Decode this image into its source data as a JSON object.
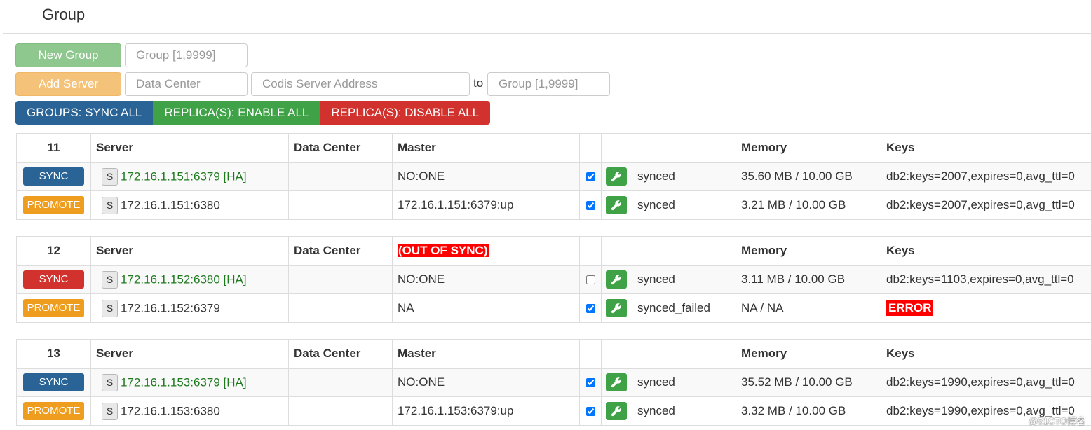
{
  "page_title": "Group",
  "toolbar": {
    "new_group_label": "New Group",
    "new_group_placeholder": "Group [1,9999]",
    "add_server_label": "Add Server",
    "data_center_placeholder": "Data Center",
    "server_address_placeholder": "Codis Server Address",
    "to_label": "to",
    "target_group_placeholder": "Group [1,9999]",
    "sync_all_label": "GROUPS: SYNC ALL",
    "enable_all_label": "REPLICA(S): ENABLE ALL",
    "disable_all_label": "REPLICA(S): DISABLE ALL"
  },
  "headers": {
    "server": "Server",
    "data_center": "Data Center",
    "master": "Master",
    "memory": "Memory",
    "keys": "Keys"
  },
  "server_button": "S",
  "groups": [
    {
      "id": "11",
      "master_header": "",
      "servers": [
        {
          "action": "SYNC",
          "address": "172.16.1.151:6379 [HA]",
          "data_center": "",
          "master": "NO:ONE",
          "checked": true,
          "status": "synced",
          "memory": "35.60 MB / 10.00 GB",
          "keys": "db2:keys=2007,expires=0,avg_ttl=0"
        },
        {
          "action": "PROMOTE",
          "address": "172.16.1.151:6380",
          "data_center": "",
          "master": "172.16.1.151:6379:up",
          "checked": true,
          "status": "synced",
          "memory": "3.21 MB / 10.00 GB",
          "keys": "db2:keys=2007,expires=0,avg_ttl=0"
        }
      ]
    },
    {
      "id": "12",
      "master_header": "(OUT OF SYNC)",
      "servers": [
        {
          "action": "SYNC",
          "address": "172.16.1.152:6380 [HA]",
          "data_center": "",
          "master": "NO:ONE",
          "checked": false,
          "status": "synced",
          "memory": "3.11 MB / 10.00 GB",
          "keys": "db2:keys=1103,expires=0,avg_ttl=0"
        },
        {
          "action": "PROMOTE",
          "address": "172.16.1.152:6379",
          "data_center": "",
          "master": "NA",
          "checked": true,
          "status": "synced_failed",
          "memory": "NA / NA",
          "keys": "ERROR"
        }
      ]
    },
    {
      "id": "13",
      "master_header": "",
      "servers": [
        {
          "action": "SYNC",
          "address": "172.16.1.153:6379 [HA]",
          "data_center": "",
          "master": "NO:ONE",
          "checked": true,
          "status": "synced",
          "memory": "35.52 MB / 10.00 GB",
          "keys": "db2:keys=1990,expires=0,avg_ttl=0"
        },
        {
          "action": "PROMOTE",
          "address": "172.16.1.153:6380",
          "data_center": "",
          "master": "172.16.1.153:6379:up",
          "checked": true,
          "status": "synced",
          "memory": "3.32 MB / 10.00 GB",
          "keys": "db2:keys=1990,expires=0,avg_ttl=0"
        }
      ]
    }
  ],
  "watermark": "@51CTO博客",
  "colors": {
    "sync_blue": "#2a6496",
    "sync_red": "#d2322d",
    "promote_orange": "#ee9d1f",
    "ha_green": "#1f7a1f",
    "error_red": "#ff0000",
    "wrench_green": "#3fa246"
  },
  "icons": {
    "server_button": "s-button",
    "edit": "wrench-icon",
    "replica_toggle": "checkbox"
  }
}
